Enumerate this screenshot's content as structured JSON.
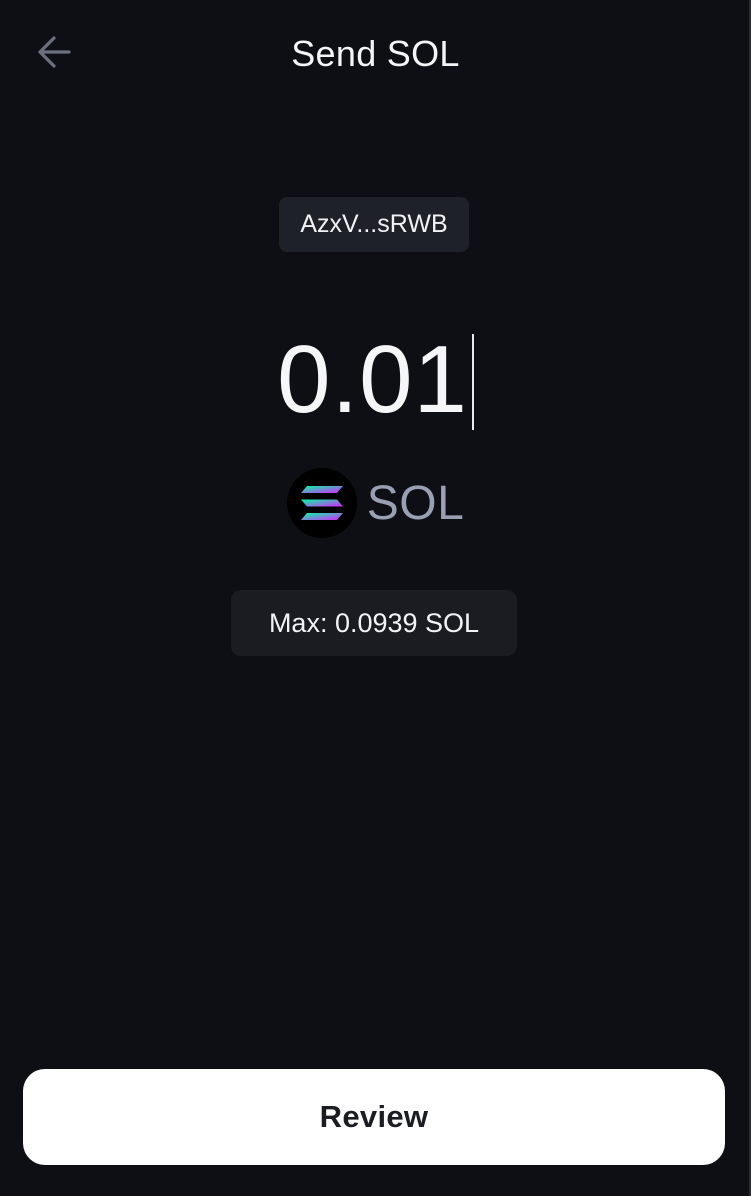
{
  "header": {
    "title": "Send SOL",
    "back_icon": "arrow-left-icon"
  },
  "recipient": {
    "address_short": "AzxV...sRWB"
  },
  "amount": {
    "value": "0.01"
  },
  "token": {
    "symbol": "SOL",
    "icon": "solana-logo-icon"
  },
  "max": {
    "label": "Max: 0.0939 SOL"
  },
  "footer": {
    "review_label": "Review"
  },
  "colors": {
    "background": "#0e0f14",
    "chip": "#1f2128",
    "primary_button": "#ffffff",
    "token_symbol": "#9aa0b4"
  }
}
